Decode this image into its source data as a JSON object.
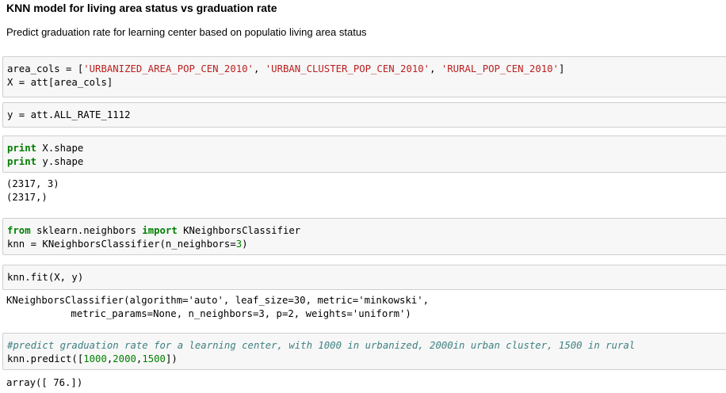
{
  "heading": "KNN model for living area status vs graduation rate",
  "description": "Predict graduation rate for learning center based on populatio living area status",
  "cells": {
    "c1": {
      "l1_a": "area_cols = [",
      "l1_s1": "'URBANIZED_AREA_POP_CEN_2010'",
      "l1_b": ", ",
      "l1_s2": "'URBAN_CLUSTER_POP_CEN_2010'",
      "l1_c": ", ",
      "l1_s3": "'RURAL_POP_CEN_2010'",
      "l1_d": "]",
      "l2": "X = att[area_cols]"
    },
    "c2": {
      "l1": "y = att.ALL_RATE_1112"
    },
    "c3": {
      "l1_kw": "print",
      "l1_rest": " X.shape",
      "l2_kw": "print",
      "l2_rest": " y.shape"
    },
    "o3": {
      "l1": "(2317, 3)",
      "l2": "(2317,)"
    },
    "c4": {
      "l1_kw1": "from",
      "l1_mod": " sklearn.neighbors ",
      "l1_kw2": "import",
      "l1_rest": " KNeighborsClassifier",
      "l2_a": "knn = KNeighborsClassifier(n_neighbors=",
      "l2_num": "3",
      "l2_b": ")"
    },
    "c5": {
      "l1": "knn.fit(X, y)"
    },
    "o5": {
      "l1": "KNeighborsClassifier(algorithm='auto', leaf_size=30, metric='minkowski',",
      "l2": "           metric_params=None, n_neighbors=3, p=2, weights='uniform')"
    },
    "c6": {
      "l1_cmt": "#predict graduation rate for a learning center, with 1000 in urbanized, 2000in urban cluster, 1500 in rural",
      "l2_a": "knn.predict([",
      "l2_n1": "1000",
      "l2_c1": ",",
      "l2_n2": "2000",
      "l2_c2": ",",
      "l2_n3": "1500",
      "l2_b": "])"
    },
    "o6": {
      "l1": "array([ 76.])"
    }
  }
}
